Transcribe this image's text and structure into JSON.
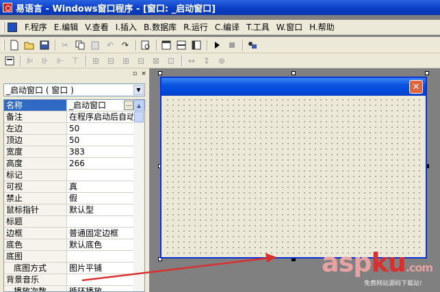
{
  "window": {
    "title": "易语言 - Windows窗口程序 - [窗口: _启动窗口]"
  },
  "menubar": {
    "items": [
      {
        "label": "F.程序"
      },
      {
        "label": "E.编辑"
      },
      {
        "label": "V.查看"
      },
      {
        "label": "I.插入"
      },
      {
        "label": "B.数据库"
      },
      {
        "label": "R.运行"
      },
      {
        "label": "C.编译"
      },
      {
        "label": "T.工具"
      },
      {
        "label": "W.窗口"
      },
      {
        "label": "H.帮助"
      }
    ]
  },
  "toolbar": {
    "icons": [
      "new-file-icon",
      "open-folder-icon",
      "save-icon",
      "cut-icon",
      "copy-icon",
      "paste-icon",
      "undo-icon",
      "redo-icon",
      "find-icon",
      "layout-left-icon",
      "layout-top-icon",
      "layout-bottom-icon",
      "run-icon",
      "stop-icon",
      "tools-icon"
    ]
  },
  "property_panel": {
    "object_selector": "_启动窗口 ( 窗口 )",
    "ellipsis": "...",
    "rows": [
      {
        "name": "名称",
        "value": "_启动窗口",
        "selected": true
      },
      {
        "name": "备注",
        "value": "在程序启动后自动"
      },
      {
        "name": "左边",
        "value": "50"
      },
      {
        "name": "顶边",
        "value": "50"
      },
      {
        "name": "宽度",
        "value": "383"
      },
      {
        "name": "高度",
        "value": "266"
      },
      {
        "name": "标记",
        "value": ""
      },
      {
        "name": "可视",
        "value": "真"
      },
      {
        "name": "禁止",
        "value": "假"
      },
      {
        "name": "鼠标指针",
        "value": "默认型"
      },
      {
        "name": "标题",
        "value": ""
      },
      {
        "name": "边框",
        "value": "普通固定边框"
      },
      {
        "name": "底色",
        "value": "默认底色"
      },
      {
        "name": "底图",
        "value": ""
      },
      {
        "name": "底图方式",
        "value": "图片平铺",
        "sub": true
      },
      {
        "name": "背景音乐",
        "value": ""
      },
      {
        "name": "播放次数",
        "value": "循环播放",
        "sub": true
      }
    ]
  },
  "form_designer": {
    "close_glyph": "✕"
  },
  "watermark": {
    "brand_main": "asp",
    "brand_accent": "ku",
    "brand_suffix": ".com",
    "tagline": "免费网站源码下载站!"
  },
  "colors": {
    "titlebar": "#0a3ec4",
    "selection": "#316ac5",
    "arrow": "#d9302f"
  }
}
